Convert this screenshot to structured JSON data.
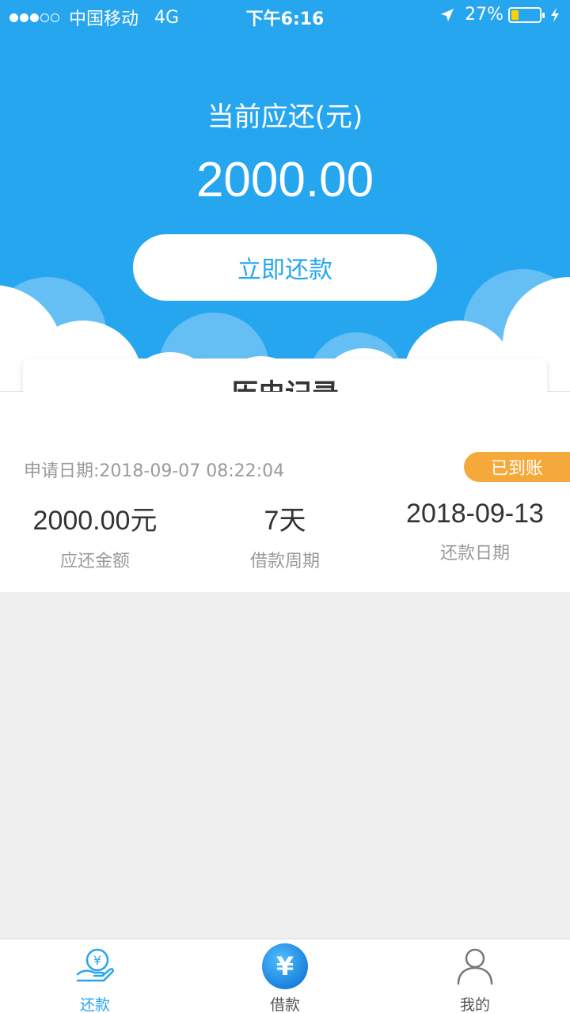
{
  "status_bar": {
    "carrier": "中国移动",
    "network": "4G",
    "time": "下午6:16",
    "battery": "27%",
    "battery_level": 0.27,
    "signal_bars_filled": 3,
    "signal_bars_total": 5
  },
  "hero": {
    "label": "当前应还(元)",
    "amount": "2000.00",
    "repay_button": "立即还款"
  },
  "history": {
    "title": "历史记录",
    "record": {
      "apply_date": "申请日期:2018-09-07 08:22:04",
      "status": "已到账",
      "amount_value": "2000.00元",
      "amount_label": "应还金额",
      "period_value": "7天",
      "period_label": "借款周期",
      "repay_date_value": "2018-09-13",
      "repay_date_label": "还款日期"
    }
  },
  "tabbar": {
    "items": [
      {
        "label": "还款",
        "icon": "hand-yen-icon",
        "active": true
      },
      {
        "label": "借款",
        "icon": "yen-circle-icon",
        "active": false
      },
      {
        "label": "我的",
        "icon": "user-icon",
        "active": false
      }
    ]
  },
  "colors": {
    "primary": "#27a6f0",
    "badge": "#f5a93a"
  }
}
